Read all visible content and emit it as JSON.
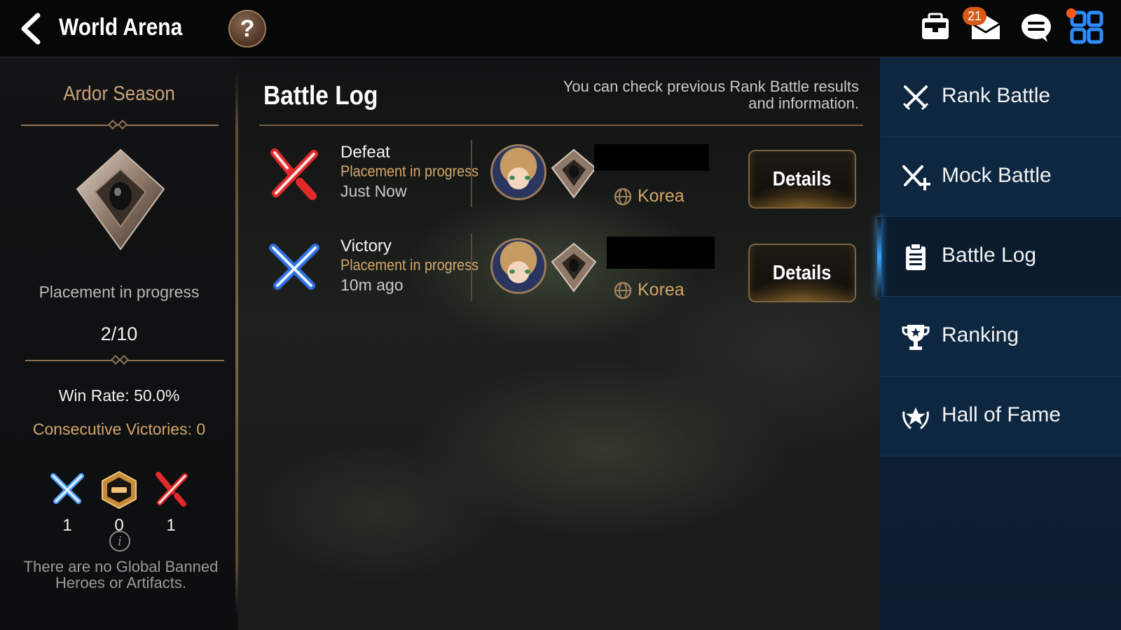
{
  "header": {
    "title": "World Arena",
    "help_label": "?",
    "mail_badge": "21"
  },
  "left_panel": {
    "season_title": "Ardor Season",
    "placement_text": "Placement in progress",
    "progress": "2/10",
    "win_rate": "Win Rate: 50.0%",
    "consecutive_victories": "Consecutive Victories: 0",
    "stats": [
      {
        "name": "wins",
        "value": "1"
      },
      {
        "name": "draws",
        "value": "0"
      },
      {
        "name": "losses",
        "value": "1"
      }
    ],
    "banned_text": "There are no Global Banned Heroes or Artifacts."
  },
  "main": {
    "title": "Battle Log",
    "description": "You can check previous Rank Battle results and information.",
    "logs": [
      {
        "result": "Defeat",
        "status": "Placement in progress",
        "time": "Just Now",
        "server": "Korea",
        "details_label": "Details"
      },
      {
        "result": "Victory",
        "status": "Placement in progress",
        "time": "10m ago",
        "server": "Korea",
        "details_label": "Details"
      }
    ]
  },
  "sidebar": {
    "items": [
      {
        "label": "Rank Battle",
        "icon": "crossed-swords-icon"
      },
      {
        "label": "Mock Battle",
        "icon": "crossed-swords-plus-icon"
      },
      {
        "label": "Battle Log",
        "icon": "clipboard-icon",
        "active": true
      },
      {
        "label": "Ranking",
        "icon": "trophy-icon"
      },
      {
        "label": "Hall of Fame",
        "icon": "laurel-star-icon"
      }
    ]
  },
  "colors": {
    "gold_accent": "#d4a66a",
    "defeat_red": "#e02a2a",
    "victory_blue": "#2f6fe0",
    "sidebar_bg": "#0e2740",
    "active_indicator": "#3aa4ff"
  }
}
